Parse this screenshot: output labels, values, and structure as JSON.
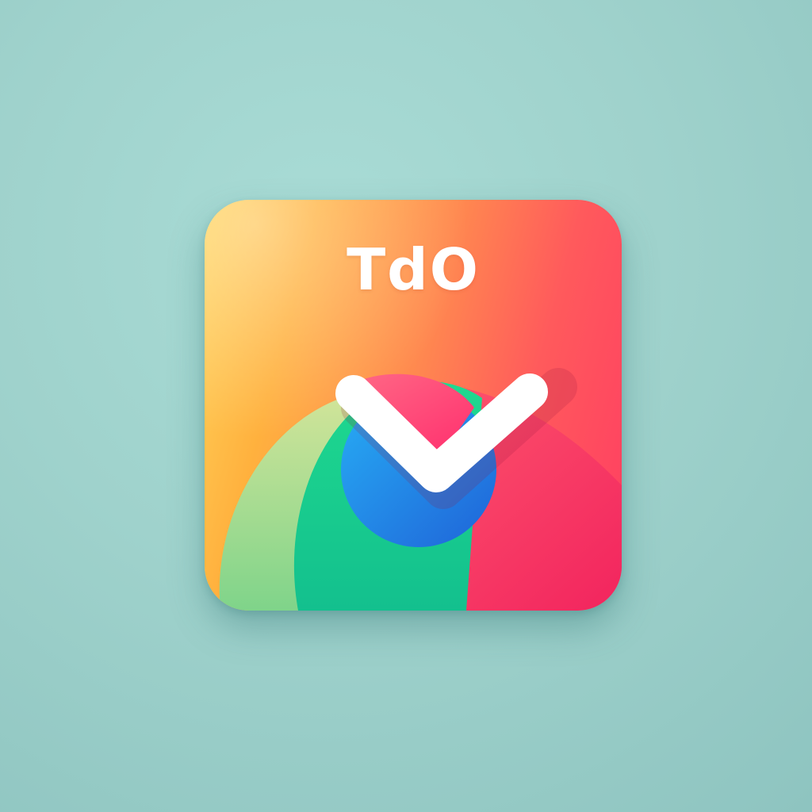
{
  "app_icon": {
    "wordmark": "TdO",
    "icon_name": "check-icon",
    "colors": {
      "background": "#9fd2cc",
      "gradient_start": "#ffc24a",
      "gradient_end": "#ff3d62",
      "green": "#18cf8c",
      "light_green": "#a8dd8a",
      "blue": "#1f87e8",
      "pink": "#ff3f7a",
      "check": "#ffffff"
    }
  }
}
